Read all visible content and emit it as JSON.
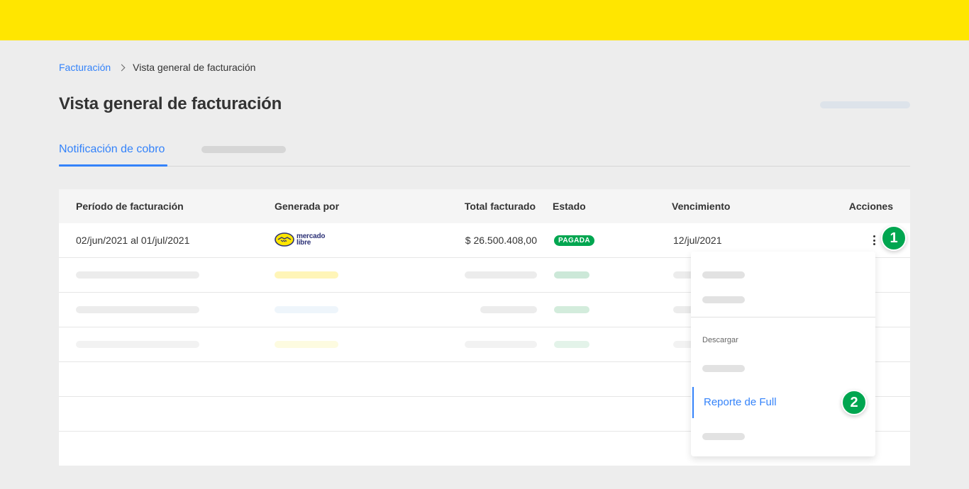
{
  "breadcrumb": {
    "parent": "Facturación",
    "current": "Vista general de facturación"
  },
  "page": {
    "title": "Vista general de facturación"
  },
  "tabs": {
    "active_label": "Notificación de cobro"
  },
  "table": {
    "headers": {
      "period": "Período de facturación",
      "generated_by": "Generada por",
      "total": "Total facturado",
      "status": "Estado",
      "due": "Vencimiento",
      "actions": "Acciones"
    },
    "first_row": {
      "period": "02/jun/2021 al 01/jul/2021",
      "logo_line1": "mercado",
      "logo_line2": "libre",
      "total": "$ 26.500.408,00",
      "status": "PAGADA",
      "due": "12/jul/2021"
    }
  },
  "menu": {
    "section_label": "Descargar",
    "active_item": "Reporte de Full"
  },
  "steps": {
    "one": "1",
    "two": "2"
  },
  "colors": {
    "topbar": "#ffe600",
    "accent": "#3483fa",
    "success": "#00a650",
    "logo_navy": "#2d3277"
  }
}
